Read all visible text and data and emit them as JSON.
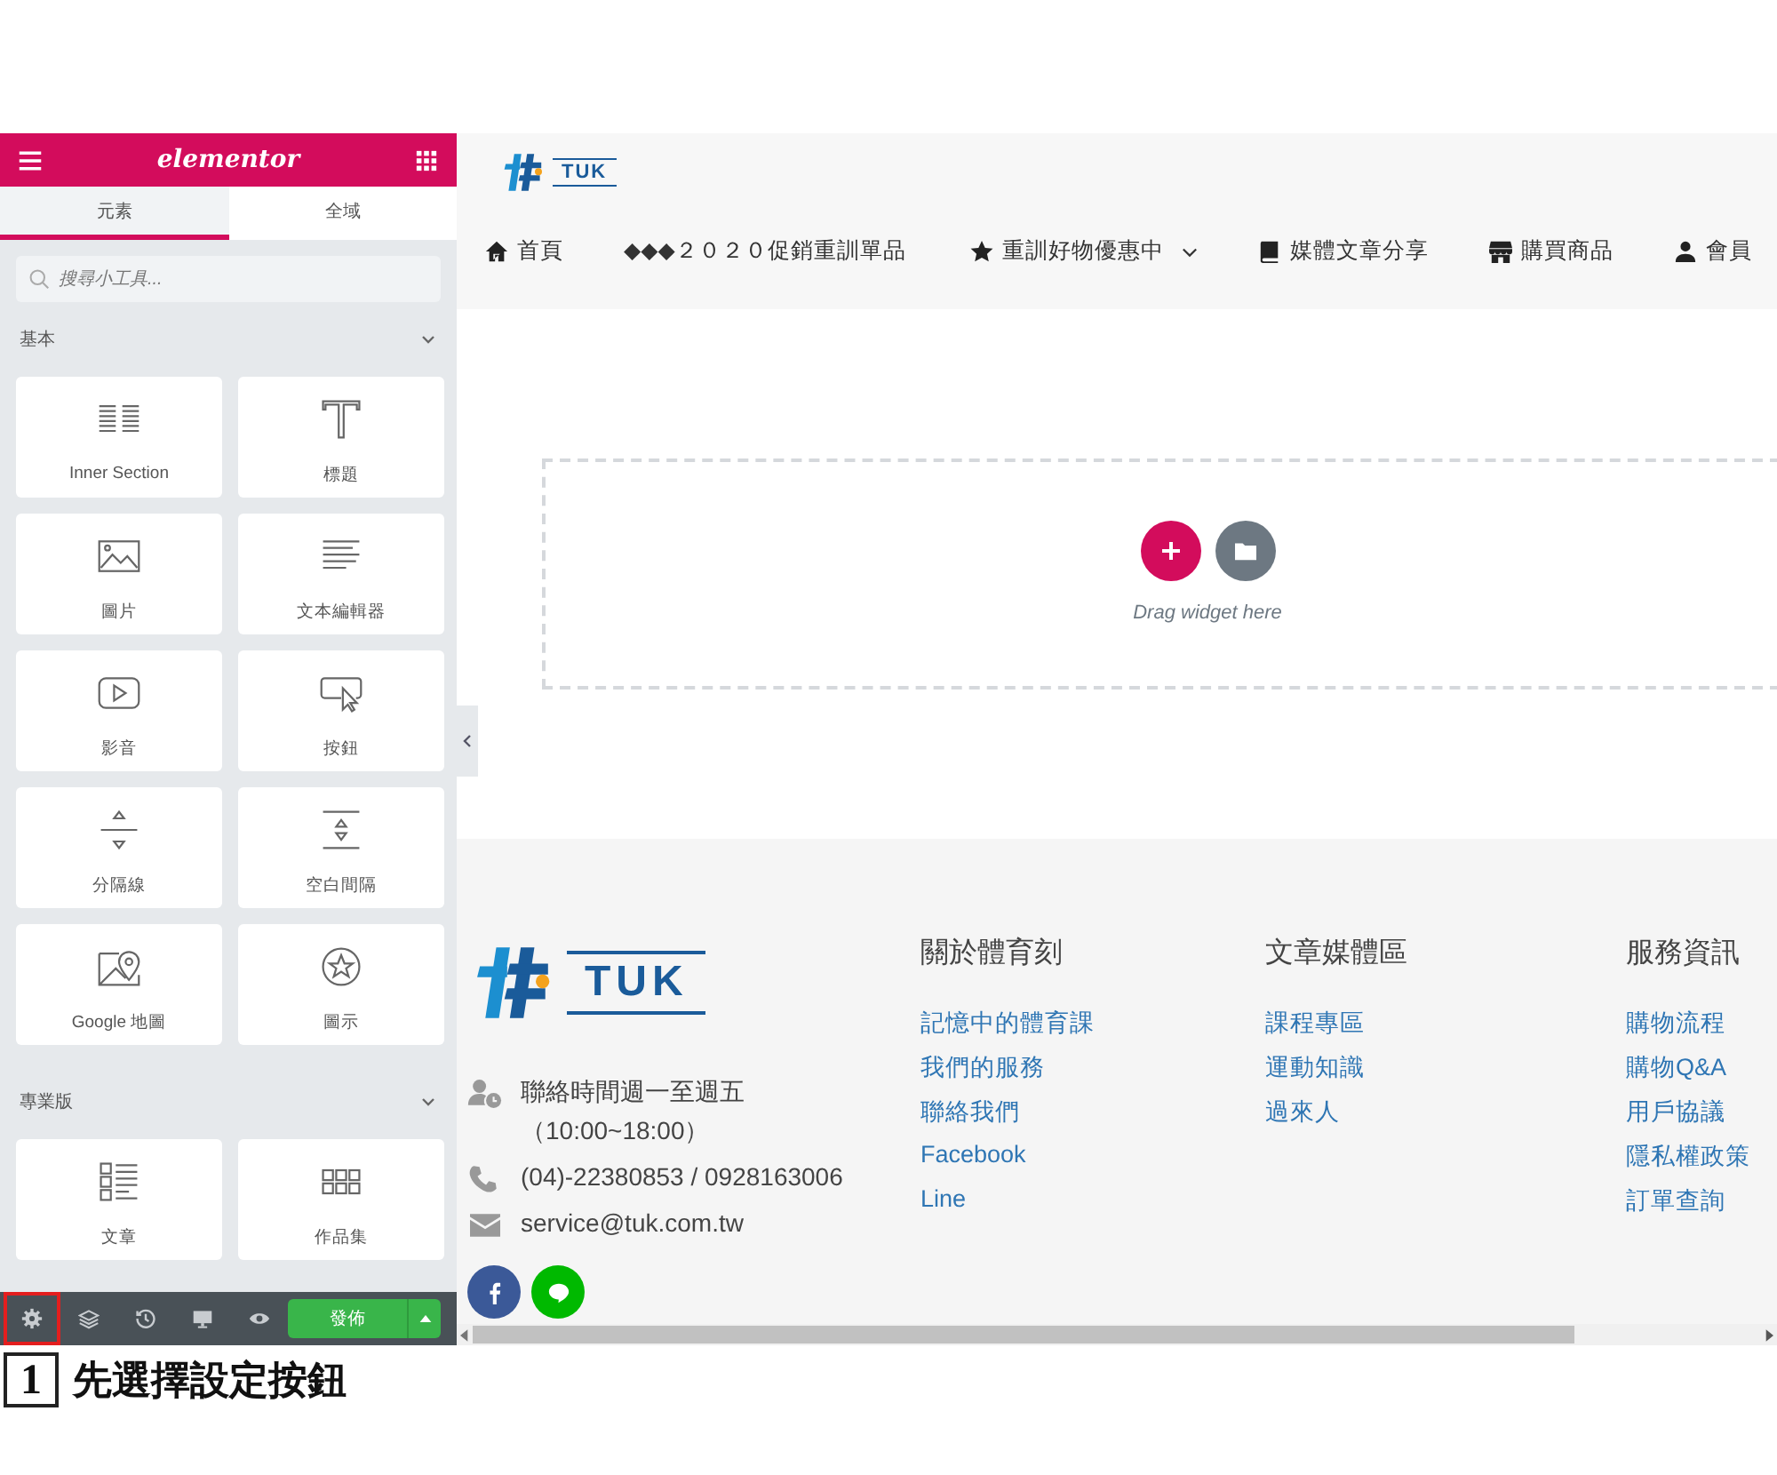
{
  "panel": {
    "logo": "elementor",
    "tabs": [
      {
        "label": "元素",
        "selected": true
      },
      {
        "label": "全域",
        "selected": false
      }
    ],
    "search": {
      "placeholder": "搜尋小工具..."
    },
    "categories": [
      {
        "title": "基本",
        "expanded": true,
        "widgets": [
          {
            "label": "Inner Section",
            "kind": "inner-section"
          },
          {
            "label": "標題",
            "kind": "heading"
          },
          {
            "label": "圖片",
            "kind": "image"
          },
          {
            "label": "文本編輯器",
            "kind": "text-editor"
          },
          {
            "label": "影音",
            "kind": "video"
          },
          {
            "label": "按鈕",
            "kind": "button"
          },
          {
            "label": "分隔線",
            "kind": "divider"
          },
          {
            "label": "空白間隔",
            "kind": "spacer"
          },
          {
            "label": "Google 地圖",
            "kind": "map"
          },
          {
            "label": "圖示",
            "kind": "icon"
          }
        ]
      },
      {
        "title": "專業版",
        "expanded": true,
        "widgets": [
          {
            "label": "文章",
            "kind": "posts"
          },
          {
            "label": "作品集",
            "kind": "portfolio"
          }
        ]
      }
    ],
    "tools": [
      {
        "kind": "settings",
        "highlighted": true
      },
      {
        "kind": "layers",
        "highlighted": false
      },
      {
        "kind": "history",
        "highlighted": false
      },
      {
        "kind": "responsive",
        "highlighted": false
      },
      {
        "kind": "preview",
        "highlighted": false
      }
    ],
    "publish": "發佈"
  },
  "site": {
    "logo": "TUK",
    "nav": [
      {
        "label": "首頁",
        "kind": "home",
        "dropdown": false
      },
      {
        "label": "◆◆◆２０２０促銷重訓單品",
        "kind": "none",
        "dropdown": false
      },
      {
        "label": "重訓好物優惠中",
        "kind": "star",
        "dropdown": true
      },
      {
        "label": "媒體文章分享",
        "kind": "book",
        "dropdown": false
      },
      {
        "label": "購買商品",
        "kind": "store",
        "dropdown": false
      },
      {
        "label": "會員",
        "kind": "user",
        "dropdown": false
      }
    ],
    "drop_zone": "Drag widget here",
    "footer": {
      "logo": "TUK",
      "contacts": [
        {
          "kind": "hours",
          "lines": [
            "聯絡時間週一至週五",
            "（10:00~18:00）"
          ]
        },
        {
          "kind": "phone",
          "lines": [
            "(04)-22380853 / 0928163006"
          ]
        },
        {
          "kind": "email",
          "lines": [
            "service@tuk.com.tw"
          ]
        }
      ],
      "socials": [
        {
          "kind": "facebook"
        },
        {
          "kind": "line"
        }
      ],
      "columns": [
        {
          "heading": "關於體育刻",
          "links": [
            "記憶中的體育課",
            "我們的服務",
            "聯絡我們",
            "Facebook",
            "Line"
          ]
        },
        {
          "heading": "文章媒體區",
          "links": [
            "課程專區",
            "運動知識",
            "過來人"
          ]
        },
        {
          "heading": "服務資訊",
          "links": [
            "購物流程",
            "購物Q&A",
            "用戶協議",
            "隱私權政策",
            "訂單查詢"
          ]
        }
      ]
    }
  },
  "caption": {
    "number": "1",
    "text": "先選擇設定按鈕"
  }
}
